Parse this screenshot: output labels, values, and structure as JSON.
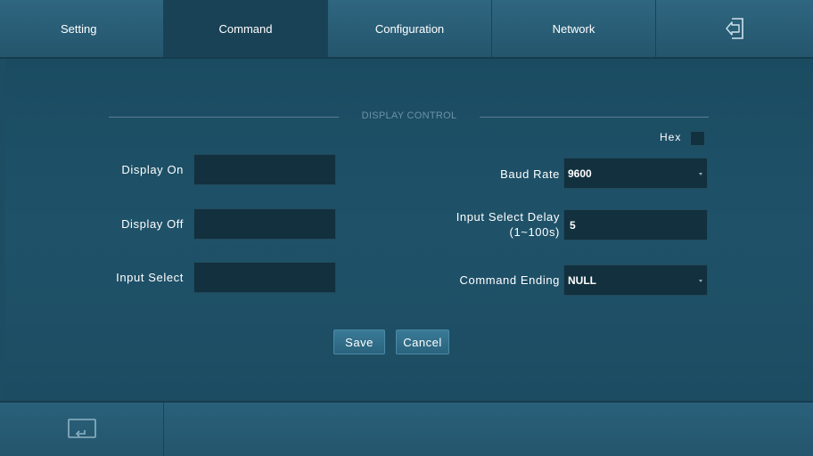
{
  "nav": {
    "tabs": [
      {
        "label": "Setting"
      },
      {
        "label": "Command"
      },
      {
        "label": "Configuration"
      },
      {
        "label": "Network"
      }
    ],
    "active_tab": "Command",
    "exit_icon": "logout-icon"
  },
  "section": {
    "title": "DISPLAY CONTROL",
    "hex_label": "Hex",
    "hex_checked": false
  },
  "left_fields": {
    "display_on_label": "Display On",
    "display_on_value": "",
    "display_off_label": "Display Off",
    "display_off_value": "",
    "input_select_label": "Input Select",
    "input_select_value": ""
  },
  "right_fields": {
    "baud_rate_label": "Baud Rate",
    "baud_rate_value": "9600",
    "delay_label_line1": "Input Select Delay",
    "delay_label_line2": "(1~100s)",
    "delay_value": "5",
    "command_ending_label": "Command Ending",
    "command_ending_value": "NULL"
  },
  "buttons": {
    "save": "Save",
    "cancel": "Cancel"
  },
  "bottom": {
    "icon": "return-icon"
  },
  "colors": {
    "background": "#1d4d63",
    "input_bg": "#12303e",
    "button": "#2f6d89",
    "muted_text": "#6d93a6"
  }
}
